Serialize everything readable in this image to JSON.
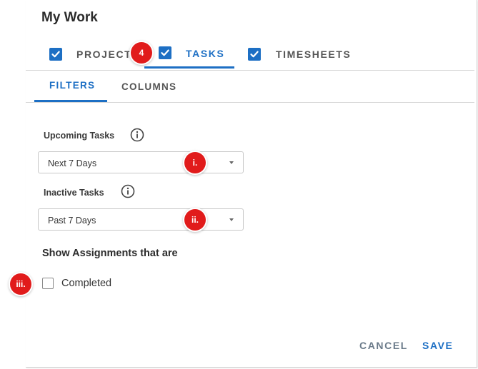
{
  "dialog": {
    "title": "My Work"
  },
  "tabs": [
    {
      "label": "PROJECTS",
      "checked": true
    },
    {
      "label": "TASKS",
      "checked": true,
      "active": true
    },
    {
      "label": "TIMESHEETS",
      "checked": true
    }
  ],
  "subtabs": [
    {
      "label": "FILTERS",
      "active": true
    },
    {
      "label": "COLUMNS"
    }
  ],
  "filters": {
    "upcoming": {
      "label": "Upcoming Tasks",
      "value": "Next 7 Days"
    },
    "inactive": {
      "label": "Inactive Tasks",
      "value": "Past 7 Days"
    }
  },
  "assignments": {
    "heading": "Show Assignments that are",
    "completed_label": "Completed",
    "completed_checked": false
  },
  "actions": {
    "cancel": "CANCEL",
    "save": "SAVE"
  },
  "markers": {
    "m4": "4",
    "mi": "i.",
    "mii": "ii.",
    "miii": "iii."
  },
  "colors": {
    "accent": "#1d6fc4",
    "marker": "#e11b1b",
    "cancel": "#6b7b8a"
  }
}
